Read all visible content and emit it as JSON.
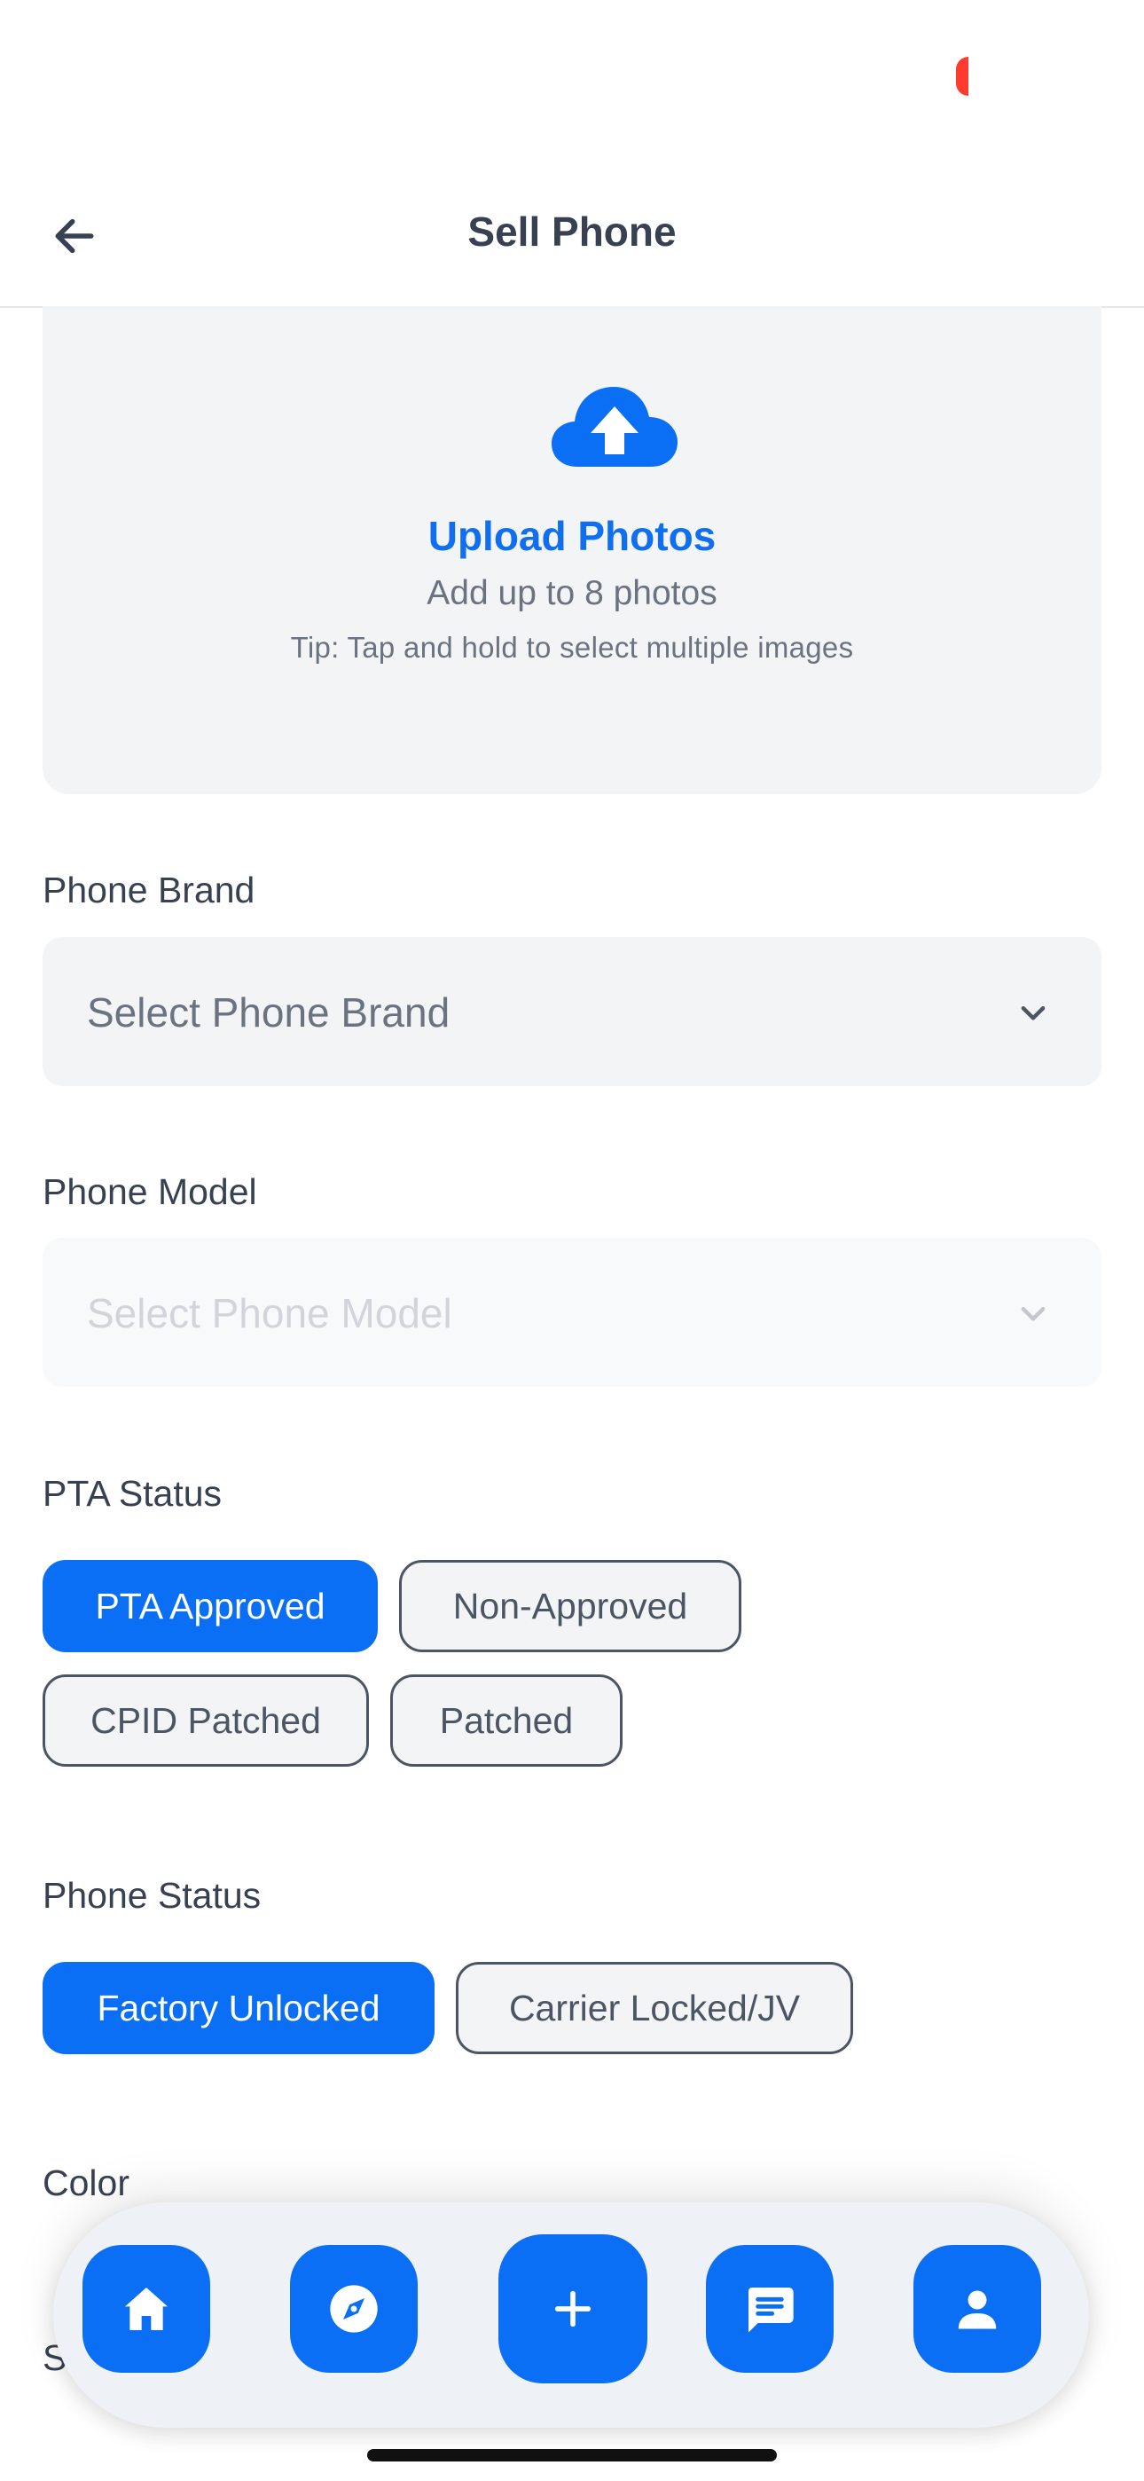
{
  "header": {
    "title": "Sell Phone",
    "back_icon": "arrow-left-icon"
  },
  "upload": {
    "icon": "cloud-upload-icon",
    "title": "Upload Photos",
    "subtitle": "Add up to 8 photos",
    "tip": "Tip: Tap and hold to select multiple images"
  },
  "brand": {
    "label": "Phone Brand",
    "placeholder": "Select Phone Brand"
  },
  "model": {
    "label": "Phone Model",
    "placeholder": "Select Phone Model",
    "disabled": true
  },
  "pta": {
    "label": "PTA Status",
    "options": [
      {
        "label": "PTA Approved",
        "selected": true
      },
      {
        "label": "Non-Approved",
        "selected": false
      },
      {
        "label": "CPID Patched",
        "selected": false
      },
      {
        "label": "Patched",
        "selected": false
      }
    ]
  },
  "phone_status": {
    "label": "Phone Status",
    "options": [
      {
        "label": "Factory Unlocked",
        "selected": true
      },
      {
        "label": "Carrier Locked/JV",
        "selected": false
      }
    ]
  },
  "color": {
    "label": "Color"
  },
  "next_section_partial": "S",
  "nav": {
    "items": [
      {
        "name": "home",
        "icon": "home-icon"
      },
      {
        "name": "explore",
        "icon": "compass-icon"
      },
      {
        "name": "create",
        "icon": "plus-icon"
      },
      {
        "name": "messages",
        "icon": "chat-icon"
      },
      {
        "name": "profile",
        "icon": "person-icon"
      }
    ]
  },
  "colors": {
    "accent": "#0a6ff5",
    "text": "#374151",
    "muted": "#6b7280",
    "field_bg": "#f3f4f6",
    "recording": "#ff3b30"
  }
}
